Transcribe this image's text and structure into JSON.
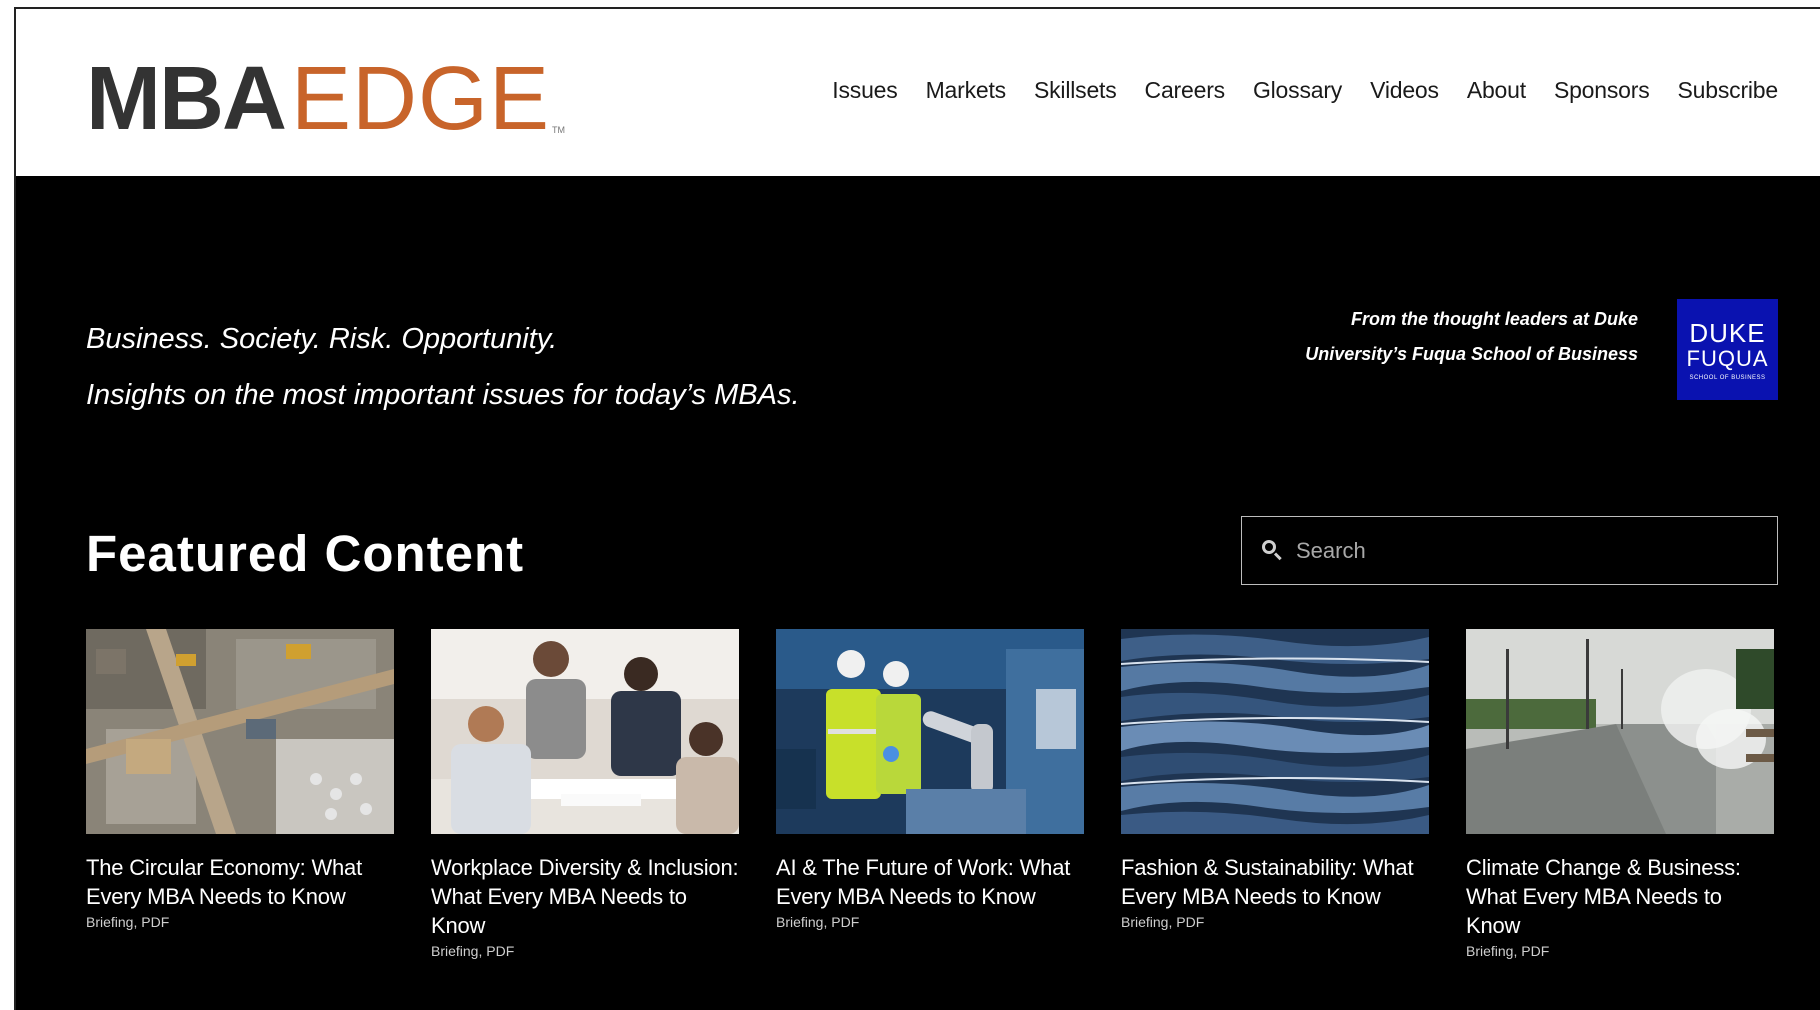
{
  "logo": {
    "part1": "MBA",
    "part2": "EDGE",
    "tm": "TM"
  },
  "nav": [
    "Issues",
    "Markets",
    "Skillsets",
    "Careers",
    "Glossary",
    "Videos",
    "About",
    "Sponsors",
    "Subscribe"
  ],
  "hero": {
    "tagline_1": "Business. Society. Risk. Opportunity.",
    "tagline_2": "Insights on the most important issues for today’s MBAs.",
    "duke_1": "From the thought leaders at Duke",
    "duke_2": "University’s Fuqua School of Business",
    "duke_logo": {
      "line1": "DUKE",
      "line2": "FUQUA",
      "line3": "SCHOOL OF BUSINESS"
    }
  },
  "featured": {
    "heading": "Featured Content",
    "search_placeholder": "Search"
  },
  "cards": [
    {
      "title": "The Circular Economy: What Every MBA Needs to Know",
      "meta": "Briefing, PDF"
    },
    {
      "title": "Workplace Diversity & Inclusion: What Every MBA Needs to Know",
      "meta": "Briefing, PDF"
    },
    {
      "title": "AI & The Future of Work: What Every MBA Needs to Know",
      "meta": "Briefing, PDF"
    },
    {
      "title": "Fashion & Sustainability: What Every MBA Needs to Know",
      "meta": "Briefing, PDF"
    },
    {
      "title": "Climate Change & Business: What Every MBA Needs to Know",
      "meta": "Briefing, PDF"
    }
  ],
  "colors": {
    "brand_dark": "#333333",
    "brand_orange": "#c8642a",
    "duke_blue": "#0a12b0",
    "background": "#000000"
  }
}
